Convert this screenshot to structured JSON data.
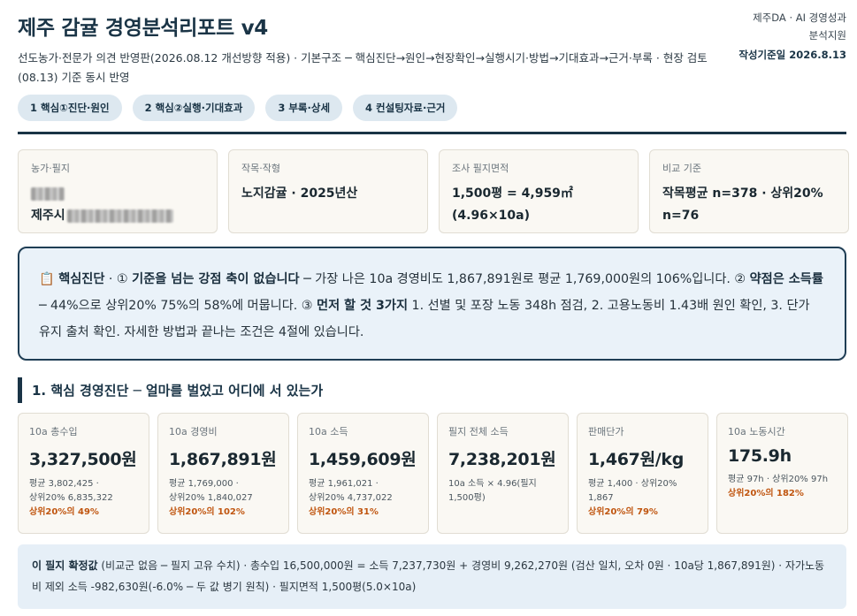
{
  "header": {
    "title": "제주 감귤 경영분석리포트 v4",
    "subtitle": "선도농가·전문가 의견 반영판(2026.08.12 개선방향 적용) · 기본구조 ─ 핵심진단→원인→현장확인→실행시기·방법→기대효과→근거·부록 · 현장 검토(08.13) 기준 동시 반영",
    "meta_line1": "제주DA · AI 경영성과",
    "meta_line2": "분석지원",
    "meta_date": "작성기준일 2026.8.13"
  },
  "tabs": [
    "1 핵심①진단·원인",
    "2 핵심②실행·기대효과",
    "3 부록·상세",
    "4 컨설팅자료·근거"
  ],
  "info_cards": {
    "farm": {
      "label": "농가·필지",
      "value": "제주시"
    },
    "crop": {
      "label": "작목·작형",
      "value": "노지감귤 · 2025년산"
    },
    "area": {
      "label": "조사 필지면적",
      "value": "1,500평 = 4,959㎡ (4.96×10a)"
    },
    "compare": {
      "label": "비교 기준",
      "value": "작목평균 n=378 · 상위20% n=76"
    }
  },
  "diagnosis": {
    "icon": "clipboard-icon",
    "head": "핵심진단",
    "p1_prefix": " · ① ",
    "p1_bold": "기준을 넘는 강점 축이 없습니다",
    "p1_text": " ─ 가장 나은 10a 경영비도 1,867,891원로 평균 1,769,000원의 106%입니다. ② ",
    "p2_bold": "약점은 소득률",
    "p2_text": " ─ 44%으로 상위20% 75%의 58%에 머뭅니다. ③ ",
    "p3_bold": "먼저 할 것 3가지",
    "p3_text": " 1. 선별 및 포장 노동 348h 점검, 2. 고용노동비 1.43배 원인 확인, 3. 단가 유지 출처 확인. 자세한 방법과 끝나는 조건은 4절에 있습니다."
  },
  "section1": {
    "title": "1. 핵심 경영진단 ─ 얼마를 벌었고 어디에 서 있는가"
  },
  "metrics": [
    {
      "label": "10a 총수입",
      "value": "3,327,500원",
      "note1": "평균 3,802,425 ·",
      "note2": "상위20% 6,835,322",
      "pct": "상위20%의 49%"
    },
    {
      "label": "10a 경영비",
      "value": "1,867,891원",
      "note1": "평균 1,769,000 ·",
      "note2": "상위20% 1,840,027",
      "pct": "상위20%의 102%"
    },
    {
      "label": "10a 소득",
      "value": "1,459,609원",
      "note1": "평균 1,961,021 ·",
      "note2": "상위20% 4,737,022",
      "pct": "상위20%의 31%"
    },
    {
      "label": "필지 전체 소득",
      "value": "7,238,201원",
      "note1": "10a 소득 × 4.96(필지",
      "note2": "1,500평)",
      "pct": ""
    },
    {
      "label": "판매단가",
      "value": "1,467원/kg",
      "note1": "평균 1,400 · 상위20%",
      "note2": "1,867",
      "pct": "상위20%의 79%"
    },
    {
      "label": "10a 노동시간",
      "value": "175.9h",
      "note1": "평균 97h · 상위20% 97h",
      "note2": "",
      "pct": "상위20%의 182%"
    }
  ],
  "footer": {
    "bold": "이 필지 확정값",
    "text": " (비교군 없음 ─ 필지 고유 수치) · 총수입 16,500,000원 = 소득 7,237,730원 + 경영비 9,262,270원 (검산 일치, 오차 0원 · 10a당 1,867,891원) · 자가노동비 제외 소득 -982,630원(-6.0% ─ 두 값 병기 원칙) · 필지면적 1,500평(5.0×10a)"
  }
}
